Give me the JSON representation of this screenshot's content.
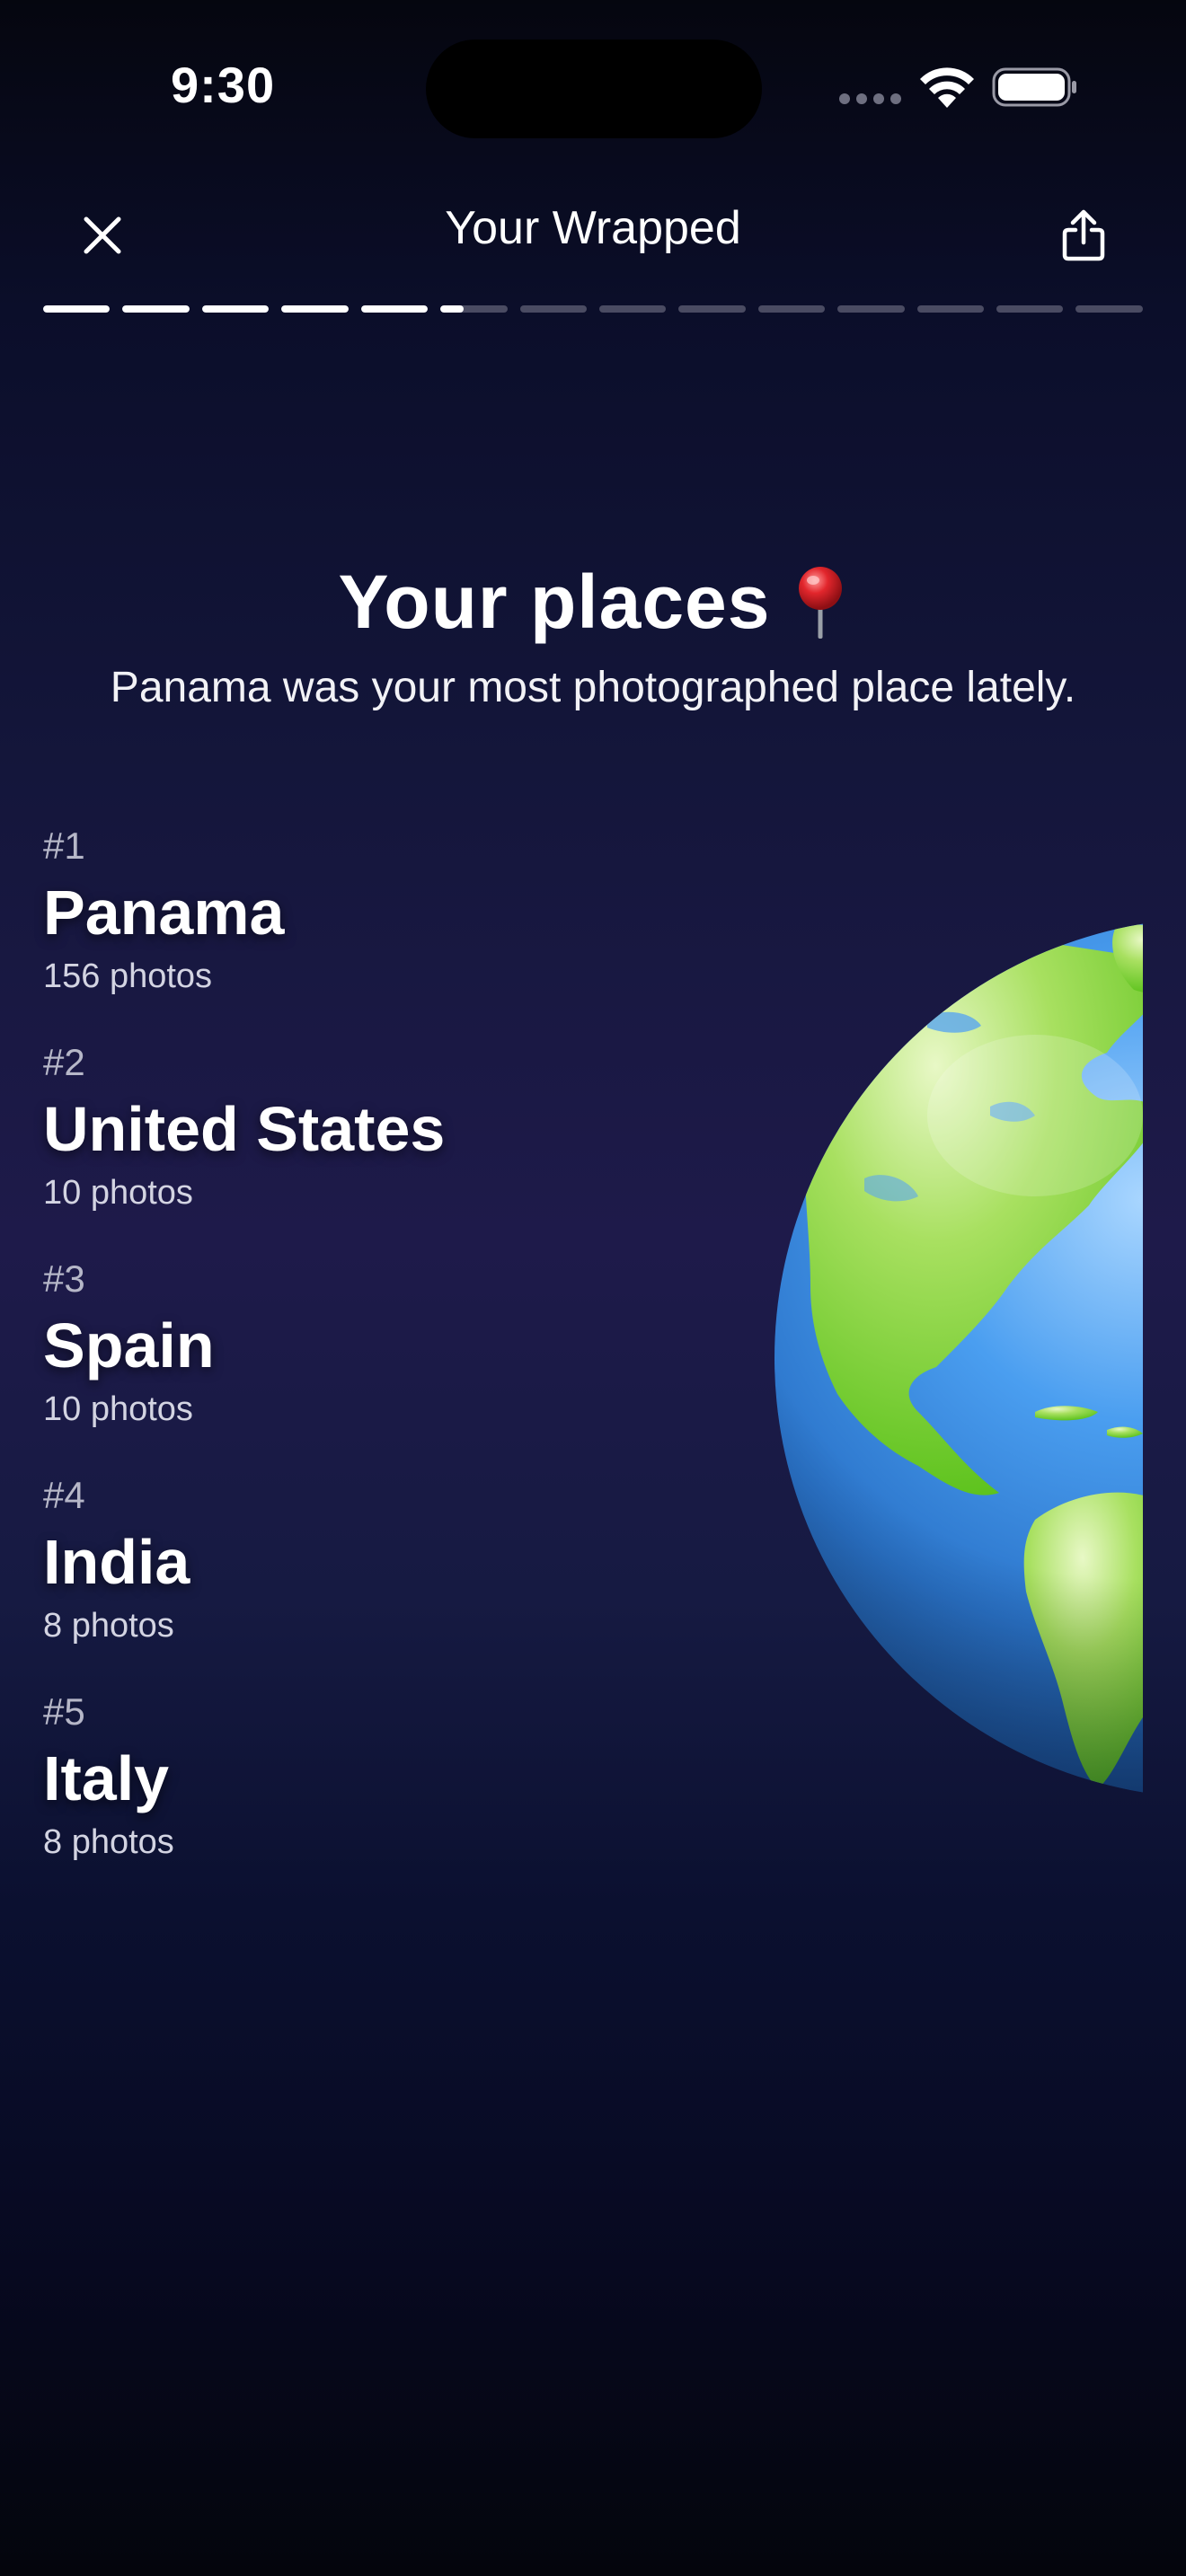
{
  "status_bar": {
    "time": "9:30"
  },
  "nav": {
    "title": "Your Wrapped"
  },
  "progress": {
    "total_segments": 14,
    "completed": 5,
    "current_fraction": 0.35
  },
  "header": {
    "title": "Your places",
    "subtitle": "Panama was your most photographed place lately."
  },
  "places": [
    {
      "rank": "#1",
      "name": "Panama",
      "count": "156 photos"
    },
    {
      "rank": "#2",
      "name": "United States",
      "count": "10 photos"
    },
    {
      "rank": "#3",
      "name": "Spain",
      "count": "10 photos"
    },
    {
      "rank": "#4",
      "name": "India",
      "count": "8 photos"
    },
    {
      "rank": "#5",
      "name": "Italy",
      "count": "8 photos"
    }
  ],
  "icons": {
    "close": "close-icon",
    "share": "share-icon",
    "pin": "round-pushpin-icon",
    "globe": "globe-americas-icon"
  },
  "colors": {
    "background_top": "#05060f",
    "background_mid": "#1e1a4a",
    "progress_active": "#ffffff",
    "progress_inactive": "#4a4b62"
  }
}
